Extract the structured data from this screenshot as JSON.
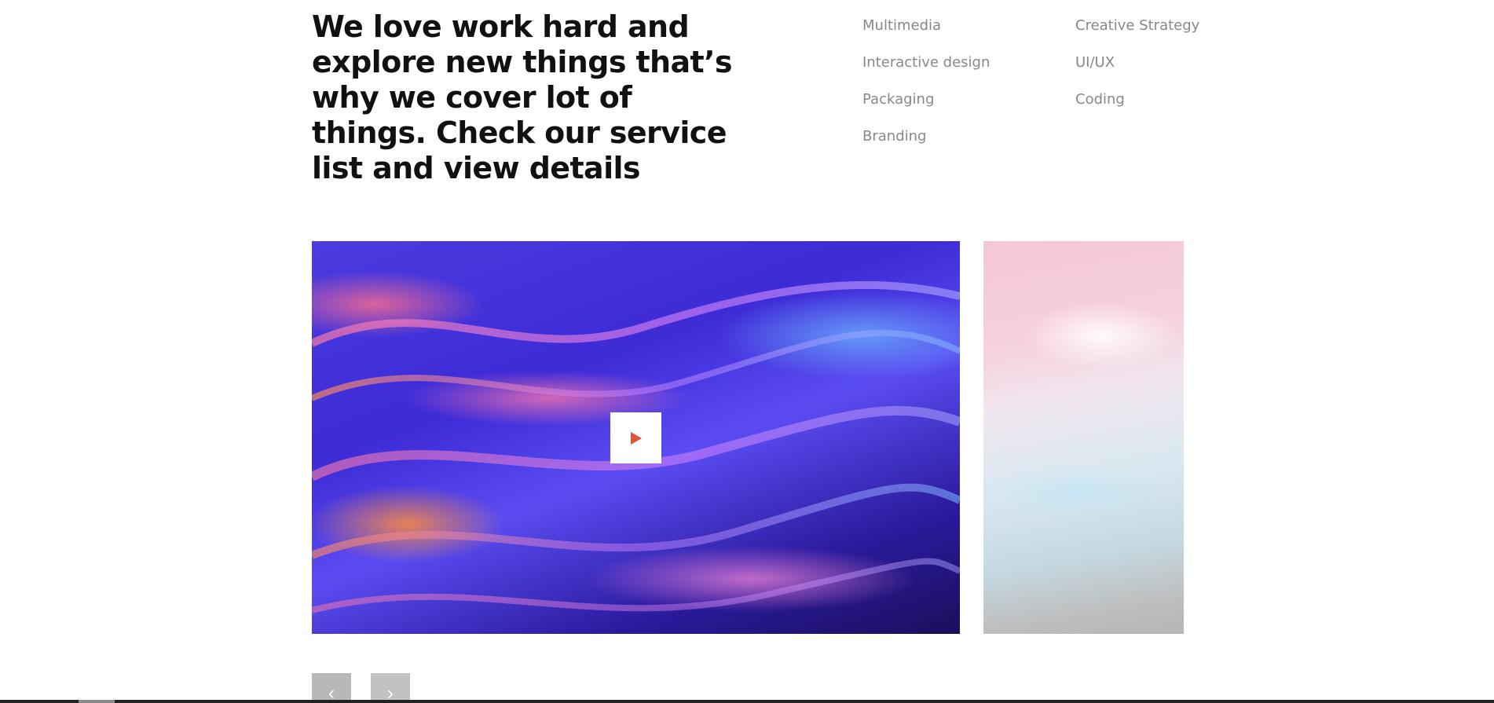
{
  "intro": {
    "headline": "We love work hard and explore new things that’s why we cover lot of things. Check our service list and view details"
  },
  "services": [
    {
      "label": "Multimedia"
    },
    {
      "label": "Creative Strategy"
    },
    {
      "label": "Interactive design"
    },
    {
      "label": "UI/UX"
    },
    {
      "label": "Packaging"
    },
    {
      "label": "Coding"
    },
    {
      "label": "Branding"
    }
  ],
  "slider": {
    "play_icon": "play-icon",
    "play_icon_color": "#e2533a",
    "prev_icon": "chevron-left-icon",
    "next_icon": "chevron-right-icon",
    "prev_glyph": "‹",
    "next_glyph": "›"
  }
}
